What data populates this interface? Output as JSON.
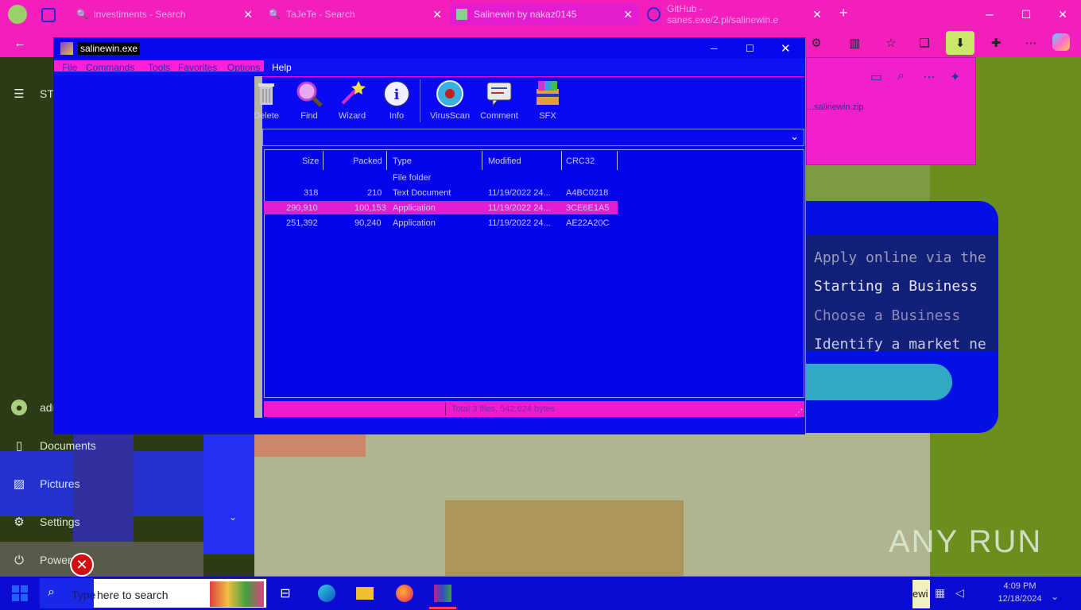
{
  "browser": {
    "tabs": [
      {
        "label": "investiments - Search"
      },
      {
        "label": "TaJeTe - Search"
      },
      {
        "label": "Salinewin by nakaz0145",
        "active": true
      },
      {
        "label": "GitHub - sanes.exe/2.pl/salinewin.e"
      }
    ],
    "new_tab": "+"
  },
  "start_menu": {
    "header": "START",
    "user": "admin",
    "items": [
      {
        "label": "Documents"
      },
      {
        "label": "Pictures"
      },
      {
        "label": "Settings"
      },
      {
        "label": "Power"
      }
    ]
  },
  "app": {
    "title": "salinewin.exe",
    "menus": [
      "File",
      "Commands",
      "Tools",
      "Favorites",
      "Options",
      "Help"
    ],
    "toolbar": [
      "Delete",
      "Find",
      "Wizard",
      "Info",
      "VirusScan",
      "Comment",
      "SFX"
    ],
    "columns": [
      "Size",
      "Packed",
      "Type",
      "Modified",
      "CRC32"
    ],
    "rows": [
      {
        "size": "",
        "packed": "",
        "type": "File folder",
        "modified": "",
        "crc": ""
      },
      {
        "size": "318",
        "packed": "210",
        "type": "Text Document",
        "modified": "11/19/2022 24...",
        "crc": "A4BC0218"
      },
      {
        "size": "290,910",
        "packed": "100,153",
        "type": "Application",
        "modified": "11/19/2022 24...",
        "crc": "3CE6E1A5"
      },
      {
        "size": "251,392",
        "packed": "90,240",
        "type": "Application",
        "modified": "11/19/2022 24...",
        "crc": "AE22A20C"
      }
    ],
    "status": "Total 3 files, 542,624 bytes"
  },
  "right_panel": {
    "pink_text": "...salinewin.zip",
    "card_lines": [
      "Apply online via the",
      "Starting a Business",
      "Choose a Business",
      "Identify a market ne"
    ]
  },
  "watermark": "ANY RUN",
  "taskbar": {
    "search_prefix": "Type",
    "search_placeholder": "here to search",
    "tray_label": "ewi",
    "time": "4:09 PM",
    "date": "12/18/2024"
  }
}
